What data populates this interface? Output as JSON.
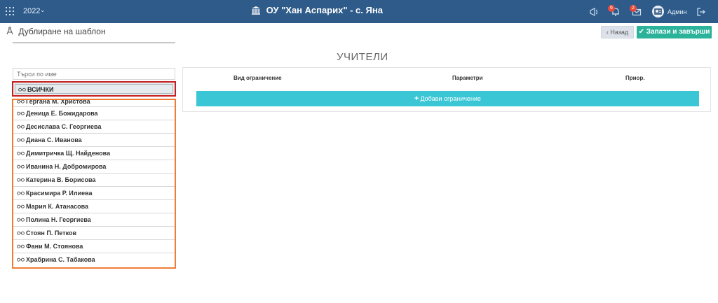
{
  "topbar": {
    "year": "2022",
    "school_name": "ОУ \"Хан Аспарих\" - с. Яна",
    "notifications_count": "6",
    "messages_count": "2",
    "user_name": "Админ",
    "bg_color": "#2e5b8a"
  },
  "page": {
    "title": "Дублиране на шаблон",
    "back_label": "Назад",
    "save_label": "Запази и завърши",
    "section_title": "УЧИТЕЛИ"
  },
  "list": {
    "search_placeholder": "Търси по име",
    "all_label": "ВСИЧКИ",
    "teachers": [
      "Гергана М. Христова",
      "Деница Е. Божидарова",
      "Десислава С. Георгиева",
      "Диана С. Иванова",
      "Димитричка Щ. Найденова",
      "Иванина Н. Добромирова",
      "Катерина В. Борисова",
      "Красимира Р. Илиева",
      "Мария К. Атанасова",
      "Полина Н. Георгиева",
      "Стоян П. Петков",
      "Фани М. Стоянова",
      "Храбрина С. Табакова"
    ]
  },
  "restrictions": {
    "col_type": "Вид ограничение",
    "col_params": "Параметри",
    "col_priority": "Приор.",
    "add_label": "Добави ограничение"
  },
  "colors": {
    "save_button": "#2ab39a",
    "add_button": "#3ac6d4",
    "selected_outline": "#c81e1e",
    "list_outline": "#ef7d37"
  }
}
